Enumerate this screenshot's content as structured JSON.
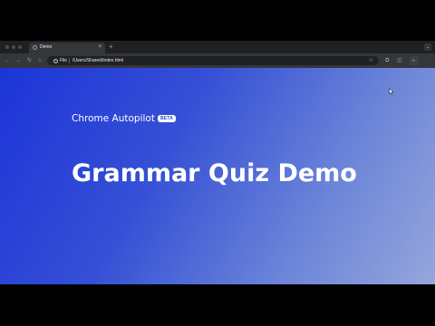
{
  "browser": {
    "tab": {
      "title": "Demo",
      "close_glyph": "×",
      "favicon": "globe-icon"
    },
    "new_tab_glyph": "+",
    "tab_menu_glyph": "⌄",
    "toolbar": {
      "back_glyph": "←",
      "forward_glyph": "→",
      "reload_glyph": "↻",
      "home_glyph": "⌂",
      "site_chip_label": "File",
      "url": "/Users/Shared/index.html",
      "star_glyph": "☆",
      "extension_glyph": "⧉",
      "sidebar_glyph": "◫",
      "profile_glyph": "⌐"
    }
  },
  "page": {
    "brand_name": "Chrome Autopilot",
    "beta_label": "BETA",
    "headline": "Grammar Quiz Demo"
  },
  "colors": {
    "gradient_start": "#1d34d8",
    "gradient_end": "#95a6dc",
    "browser_chrome": "#35363a"
  }
}
